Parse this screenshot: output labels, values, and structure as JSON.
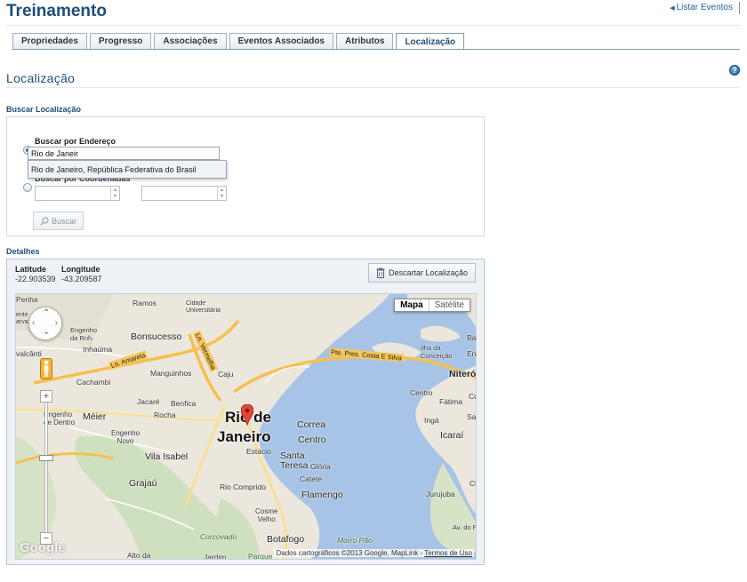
{
  "app_title": "Treinamento",
  "top_link": "Listar Eventos",
  "tabs": [
    {
      "label": "Propriedades"
    },
    {
      "label": "Progresso"
    },
    {
      "label": "Associações"
    },
    {
      "label": "Eventos Associados"
    },
    {
      "label": "Atributos"
    },
    {
      "label": "Localização"
    }
  ],
  "active_tab": "Localização",
  "section_title": "Localização",
  "search": {
    "heading": "Buscar Localização",
    "by_address_label": "Buscar por Endereço",
    "address_value": "Rio de Janeir",
    "suggestion": "Rio de Janeiro, República Federativa do Brasil",
    "by_coords_label": "Buscar por Coordenadas",
    "lat_value": "",
    "lng_value": "",
    "button_label": "Buscar"
  },
  "details": {
    "heading": "Detalhes",
    "latitude_label": "Latitude",
    "latitude_value": "-22.903539",
    "longitude_label": "Longitude",
    "longitude_value": "-43.209587",
    "discard_button": "Descartar Localização"
  },
  "map": {
    "type_map": "Mapa",
    "type_satellite": "Satélite",
    "city_line1": "Rio de",
    "city_line2": "Janeiro",
    "logo": "Google",
    "credits": "Dados cartográficos ©2013 Google, MapLink -",
    "terms": "Termos de Uso",
    "roads": {
      "ponte": "Pte. Pres. Costa E Silva",
      "amarela": "Ln. Amarela",
      "vermelha": "Ln. Vermelha"
    },
    "places": {
      "penha": "Penha",
      "ramos": "Ramos",
      "cidade_univ1": "Cidade",
      "cidade_univ2": "Universitária",
      "engenho_rnh1": "Engenho",
      "engenho_rnh2": "da Rnh.",
      "bonsucesso": "Bonsucesso",
      "inhauma": "Inhaúma",
      "cavalcanti": "valcânti",
      "manguinhos": "Manguinhos",
      "caju": "Caju",
      "cachambi": "Cachambi",
      "jacare": "Jacaré",
      "benfica": "Benfica",
      "rocha": "Rocha",
      "meier": "Méier",
      "engenho_dentro1": "Engenho",
      "engenho_dentro2": "de Dentro",
      "engenho_novo1": "Engenho",
      "engenho_novo2": "Novo",
      "vila_isabel": "Vila Isabel",
      "grajau": "Grajaú",
      "estacio": "Estácio",
      "santa_teresa1": "Santa",
      "santa_teresa2": "Teresa",
      "gloria": "Glória",
      "catete": "Catete",
      "rio_comprido": "Rio Comprido",
      "flamengo": "Flamengo",
      "cosme_velho1": "Cosme",
      "cosme_velho2": "Velho",
      "corcovado": "Corcovado",
      "botafogo": "Botafogo",
      "morro_pao": "Morro Pão",
      "alto_boa": "Alto da",
      "jardim": "Jardim",
      "parque": "Parque",
      "correa": "Correa",
      "centro": "Centro",
      "niteroi": "Niterói",
      "centro_nit": "Centro",
      "fatima": "Fátima",
      "inga": "Ingá",
      "icarai": "Icaraí",
      "ilha_conc1": "Ilha da",
      "ilha_conc2": "Conceição",
      "jurujuba": "Jurujuba",
      "av_forte": "Av. do For",
      "barr": "Barr",
      "eng": "Eng",
      "san": "San",
      "cu": "Cu",
      "ch": "Ch",
      "sente": "ente",
      "sarva": "arva"
    }
  }
}
